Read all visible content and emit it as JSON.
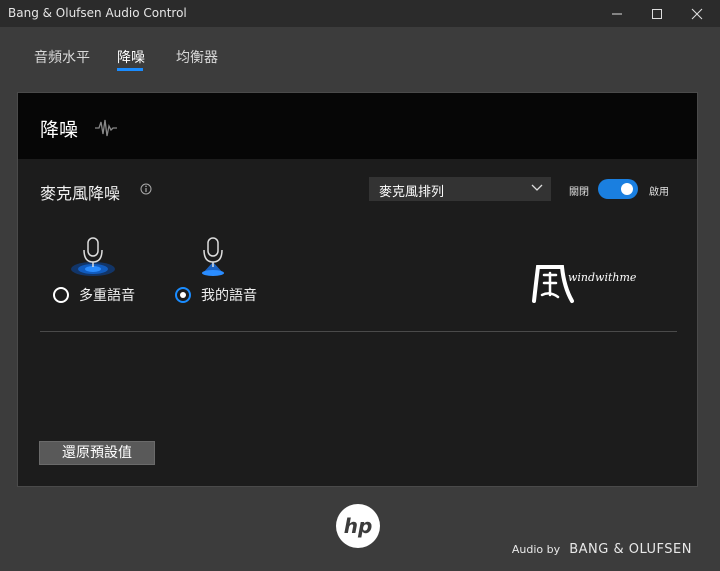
{
  "window": {
    "title": "Bang & Olufsen Audio Control",
    "controls": [
      "minimize-icon",
      "maximize-icon",
      "close-icon"
    ]
  },
  "tabs": [
    {
      "label": "音頻水平",
      "active": false
    },
    {
      "label": "降噪",
      "active": true
    },
    {
      "label": "均衡器",
      "active": false
    }
  ],
  "panel": {
    "title": "降噪",
    "title_icon": "waveform-icon",
    "section": {
      "title": "麥克風降噪",
      "info_icon": "info-icon",
      "dropdown": {
        "selected": "麥克風排列"
      },
      "toggle": {
        "off_label": "關閉",
        "on_label": "啟用",
        "state": "on"
      }
    },
    "options": [
      {
        "label": "多重語音",
        "selected": false,
        "icon": "microphone-multi-icon"
      },
      {
        "label": "我的語音",
        "selected": true,
        "icon": "microphone-single-icon"
      }
    ],
    "watermark": {
      "glyph": "風",
      "text": "windwithme"
    },
    "reset_button": "還原預設值"
  },
  "footer": {
    "logo": "hp",
    "brand_small": "Audio by",
    "brand_big": "BANG & OLUFSEN"
  },
  "colors": {
    "accent": "#1a8cff",
    "toggle": "#1a7fe0",
    "background": "#3c3c3c",
    "panel": "#1c1c1c"
  }
}
